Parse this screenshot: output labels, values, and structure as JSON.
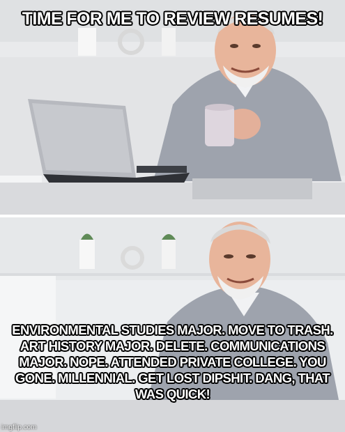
{
  "meme": {
    "top_text": "TIME FOR ME TO REVIEW RESUMES!",
    "bottom_text": "ENVIRONMENTAL STUDIES MAJOR. MOVE TO TRASH.  ART HISTORY MAJOR.  DELETE.  COMMUNICATIONS MAJOR.  NOPE.  ATTENDED PRIVATE COLLEGE.  YOU GONE.  MILLENNIAL.  GET LOST DIPSHIT.  DANG, THAT WAS QUICK!",
    "watermark": "imgflip.com"
  }
}
